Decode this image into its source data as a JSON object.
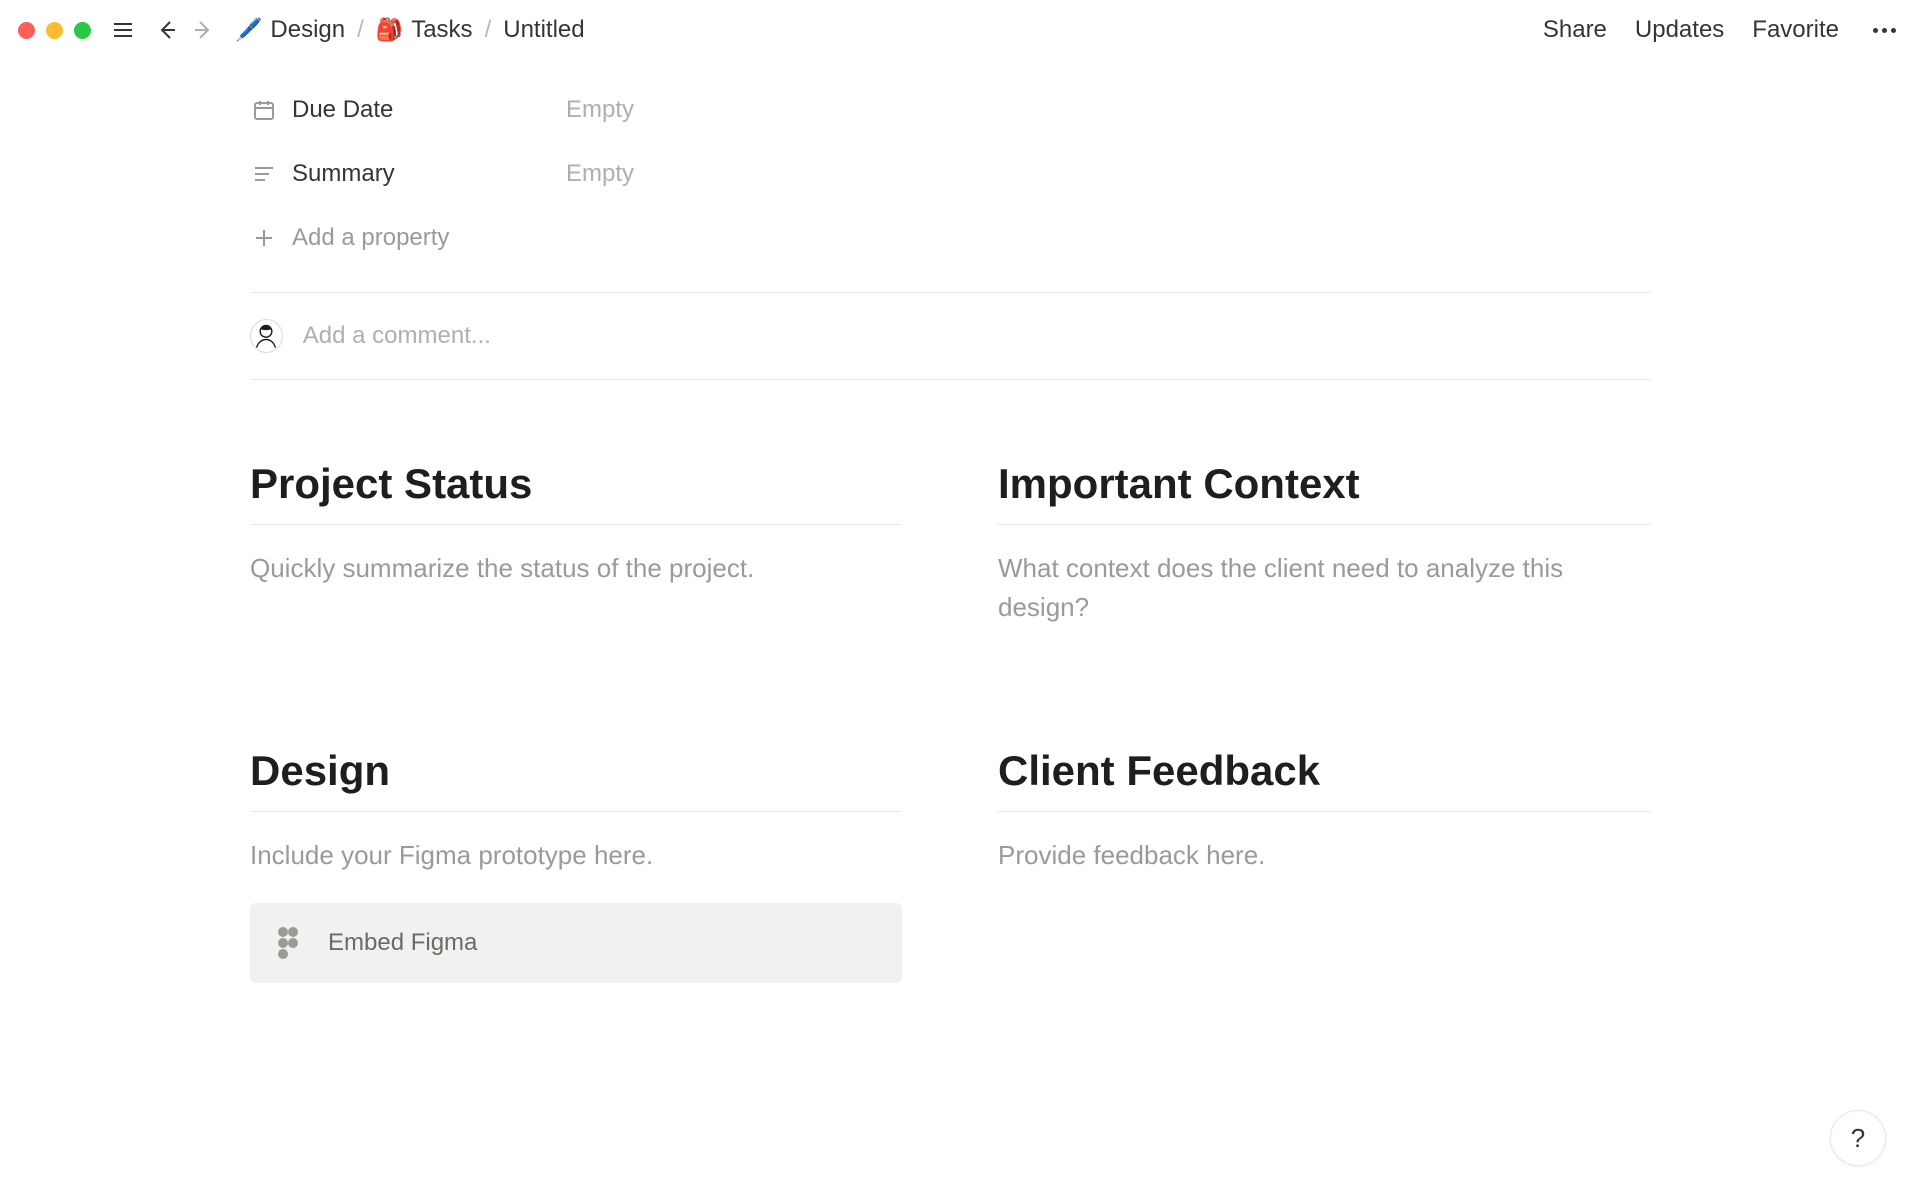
{
  "breadcrumb": {
    "item1_icon": "🖊️",
    "item1_label": "Design",
    "item2_icon": "🎒",
    "item2_label": "Tasks",
    "item3_label": "Untitled"
  },
  "topbar": {
    "share": "Share",
    "updates": "Updates",
    "favorite": "Favorite"
  },
  "properties": {
    "due_date_label": "Due Date",
    "due_date_value": "Empty",
    "summary_label": "Summary",
    "summary_value": "Empty",
    "add_property_label": "Add a property"
  },
  "comment": {
    "placeholder": "Add a comment..."
  },
  "sections": {
    "status_title": "Project Status",
    "status_body": "Quickly summarize the status of the project.",
    "context_title": "Important Context",
    "context_body": "What context does the client need to analyze this design?",
    "design_title": "Design",
    "design_body": "Include your Figma prototype here.",
    "feedback_title": "Client Feedback",
    "feedback_body": "Provide feedback here."
  },
  "embed": {
    "label": "Embed Figma"
  },
  "help": {
    "label": "?"
  }
}
